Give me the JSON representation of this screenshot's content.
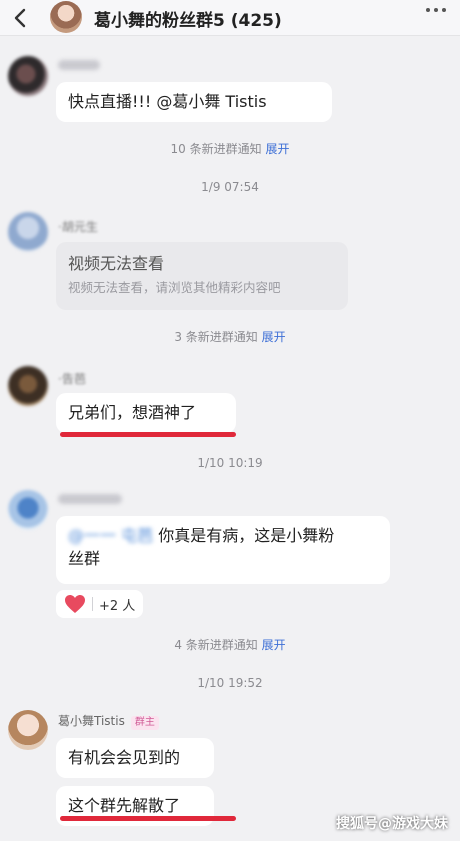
{
  "header": {
    "title": "葛小舞的粉丝群5 (425)"
  },
  "messages": {
    "m1": {
      "text": "快点直播!!! @葛小舞 Tistis"
    },
    "m2": {
      "title": "视频无法查看",
      "subtitle": "视频无法查看，请浏览其他精彩内容吧",
      "nick": "·胡元生"
    },
    "m3": {
      "text": "兄弟们，想酒神了",
      "nick": "·告芭"
    },
    "m4": {
      "text_line1": "你真是有病，这是小舞粉",
      "text_line2": "丝群",
      "mention_blurred": "@一一 屯芭"
    },
    "m5": {
      "nick": "葛小舞Tistis",
      "badge": "群主",
      "text": "有机会会见到的"
    },
    "m6": {
      "text": "这个群先解散了"
    }
  },
  "system": {
    "notice1": {
      "count_text": "10 条新进群通知",
      "link": "展开"
    },
    "time1": "1/9 07:54",
    "notice2": {
      "count_text": "3 条新进群通知",
      "link": "展开"
    },
    "time2": "1/10 10:19",
    "notice3": {
      "count_text": "4 条新进群通知",
      "link": "展开"
    },
    "time3": "1/10 19:52"
  },
  "reaction": {
    "emoji": "heart",
    "count": "+2 人"
  },
  "watermark": "搜狐号@游戏大妹",
  "colors": {
    "link": "#3d6fd6",
    "highlight": "#e0283a",
    "badge": "#d05b96"
  }
}
